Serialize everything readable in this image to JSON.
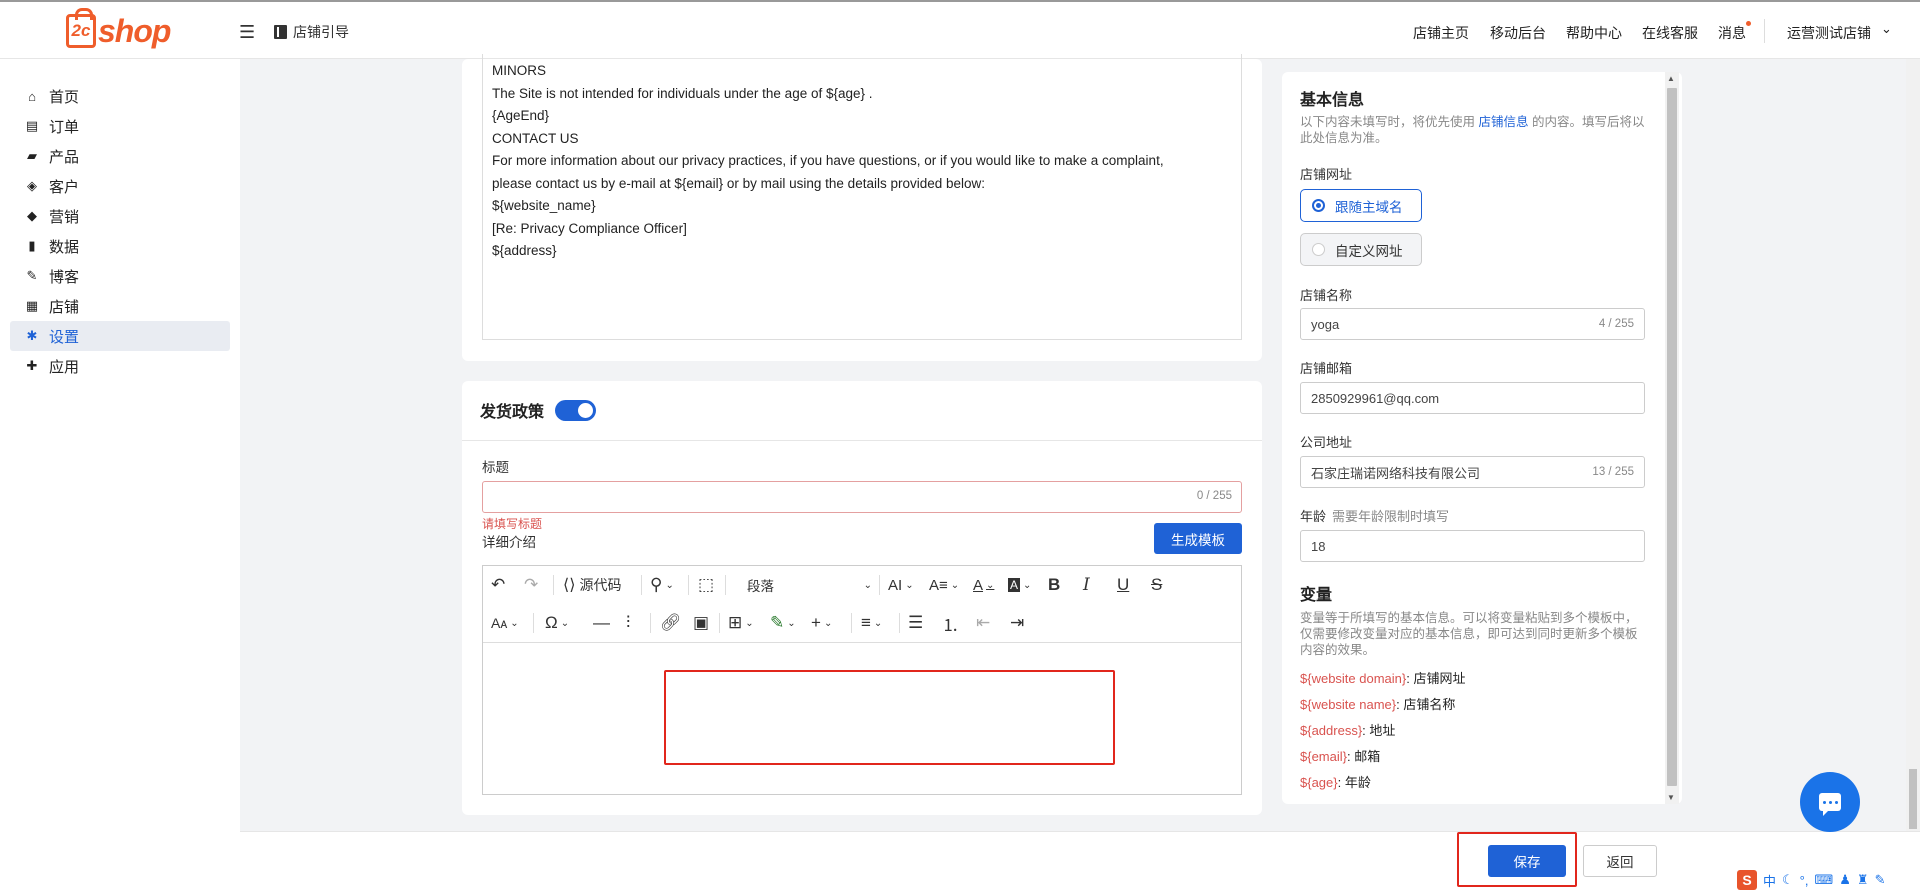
{
  "header": {
    "logo_prefix": "2c",
    "logo_word": "shop",
    "guide_label": "店铺引导",
    "nav": [
      "店铺主页",
      "移动后台",
      "帮助中心",
      "在线客服",
      "消息"
    ],
    "store_name": "运营测试店铺"
  },
  "sidebar": {
    "items": [
      {
        "label": "首页",
        "icon": "home-icon"
      },
      {
        "label": "订单",
        "icon": "clipboard-icon"
      },
      {
        "label": "产品",
        "icon": "bag-icon"
      },
      {
        "label": "客户",
        "icon": "diamond-icon"
      },
      {
        "label": "营销",
        "icon": "tag-icon"
      },
      {
        "label": "数据",
        "icon": "bar-chart-icon"
      },
      {
        "label": "博客",
        "icon": "edit-icon"
      },
      {
        "label": "店铺",
        "icon": "store-icon"
      },
      {
        "label": "设置",
        "icon": "gear-icon"
      },
      {
        "label": "应用",
        "icon": "puzzle-icon"
      }
    ],
    "active_index": 8
  },
  "policy_text": [
    "MINORS",
    "",
    "The Site is not intended for individuals under the age of ${age} .",
    "{AgeEnd}",
    "CONTACT US",
    "",
    "For more information about our privacy practices, if you have questions, or if you would like to make a complaint,",
    "please contact us by e-mail at ${email} or by mail using the details provided below:",
    "${website_name}",
    "[Re: Privacy Compliance Officer]",
    "${address}"
  ],
  "shipping": {
    "section_title": "发货政策",
    "enabled": true,
    "title_label": "标题",
    "title_value": "",
    "title_counter": "0 / 255",
    "title_error": "请填写标题",
    "detail_label": "详细介绍",
    "generate_button": "生成模板",
    "toolbar": {
      "source_code": "源代码",
      "paragraph": "段落"
    }
  },
  "basic_info": {
    "title": "基本信息",
    "desc_before": "以下内容未填写时，将优先使用 ",
    "desc_link": "店铺信息",
    "desc_after": " 的内容。填写后将以此处信息为准。",
    "store_url_label": "店铺网址",
    "url_options": [
      "跟随主域名",
      "自定义网址"
    ],
    "selected_url_option": 0,
    "store_name_label": "店铺名称",
    "store_name_value": "yoga",
    "store_name_counter": "4 / 255",
    "store_email_label": "店铺邮箱",
    "store_email_value": "2850929961@qq.com",
    "company_address_label": "公司地址",
    "company_address_value": "石家庄瑞诺网络科技有限公司",
    "company_address_counter": "13 / 255",
    "age_label": "年龄",
    "age_hint": "需要年龄限制时填写",
    "age_value": "18"
  },
  "variables": {
    "title": "变量",
    "desc": "变量等于所填写的基本信息。可以将变量粘贴到多个模板中，仅需要修改变量对应的基本信息，即可达到同时更新多个模板内容的效果。",
    "items": [
      {
        "key": "${website domain}",
        "value": ": 店铺网址"
      },
      {
        "key": "${website name}",
        "value": ": 店铺名称"
      },
      {
        "key": "${address}",
        "value": ": 地址"
      },
      {
        "key": "${email}",
        "value": ": 邮箱"
      },
      {
        "key": "${age}",
        "value": ": 年龄"
      }
    ]
  },
  "footer": {
    "save_label": "保存",
    "back_label": "返回"
  },
  "ime": {
    "logo": "S",
    "mode": "中"
  },
  "colors": {
    "accent": "#1f62d6",
    "brand": "#ef5d2b",
    "error": "#d9534f",
    "highlight_box": "#e1261c"
  }
}
